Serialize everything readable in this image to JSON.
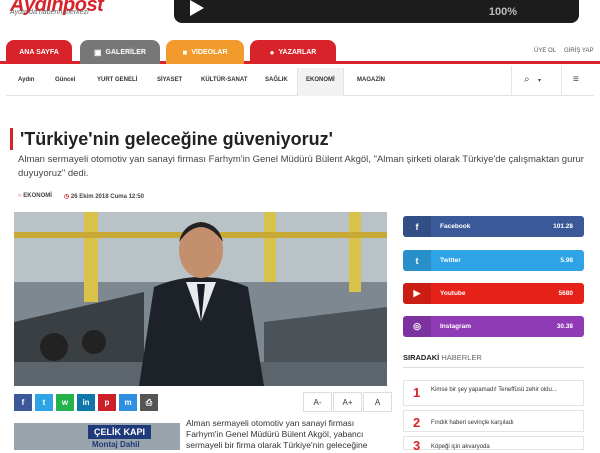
{
  "brand": {
    "logo": "Aydinpost",
    "slogan": "Aydın'da haberin merkezi"
  },
  "video": {
    "progress_label": "100%"
  },
  "tabs": [
    {
      "label": "ANA SAYFA",
      "icon": "home-icon"
    },
    {
      "label": "GALERİLER",
      "icon": "image-icon"
    },
    {
      "label": "VİDEOLAR",
      "icon": "video-icon"
    },
    {
      "label": "YAZARLAR",
      "icon": "users-icon"
    }
  ],
  "top_links": {
    "signup": "ÜYE OL",
    "login": "GİRİŞ YAP"
  },
  "subnav": [
    "Aydın",
    "Güncel",
    "YURT GENELİ",
    "SİYASET",
    "KÜLTÜR-SANAT",
    "SAĞLIK",
    "EKONOMİ",
    "MAGAZİN"
  ],
  "article": {
    "title": "'Türkiye'nin geleceğine güveniyoruz'",
    "lead": "Alman sermayeli otomotiv yan sanayi firması Farhym'in Genel Müdürü Bülent Akgöl, \"Alman şirketi olarak Türkiye'de çalışmaktan gurur duyuyoruz\" dedi.",
    "category": "EKONOMİ",
    "date": "26 Ekim 2018 Cuma 12:50",
    "body": "Alman sermayeli otomotiv yan sanayi firması Farhym'in Genel Müdürü Bülent Akgöl, yabancı sermayeli bir firma olarak Türkiye'nin geleceğine"
  },
  "font_controls": [
    "A-",
    "A+",
    "A"
  ],
  "ad": {
    "title": "ÇELİK KAPI",
    "subtitle": "Montaj Dahil"
  },
  "social": [
    {
      "name": "Facebook",
      "count": "101.28",
      "color": "#3b5998",
      "icon": "facebook-icon",
      "glyph": "f"
    },
    {
      "name": "Twitter",
      "count": "5.98",
      "color": "#2ea3e6",
      "icon": "twitter-icon",
      "glyph": "t"
    },
    {
      "name": "Youtube",
      "count": "5680",
      "color": "#e62117",
      "icon": "youtube-icon",
      "glyph": "▶"
    },
    {
      "name": "Instagram",
      "count": "30.38",
      "color": "#8e3bb5",
      "icon": "instagram-icon",
      "glyph": "◎"
    }
  ],
  "section": {
    "title_bold": "SIRADAKİ",
    "title_rest": "HABERLER"
  },
  "next_news": [
    {
      "num": "1",
      "text": "Kimse bir şey yapamadı! Teneffüsü zehir oldu..."
    },
    {
      "num": "2",
      "text": "Fındık haberi sevinçle karşıladı"
    },
    {
      "num": "3",
      "text": "Köpeği için akvaryoda"
    }
  ],
  "colors": {
    "brand_red": "#d8232a",
    "gallery_gray": "#777777",
    "video_orange": "#f39a2d"
  }
}
